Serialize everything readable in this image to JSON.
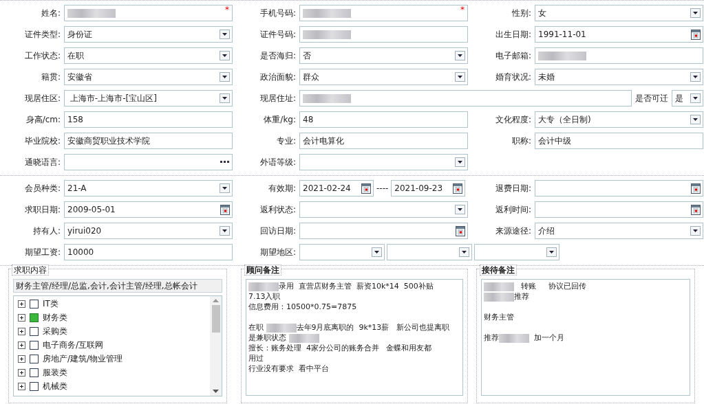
{
  "sections": [
    {
      "fields": [
        {
          "label": "姓名:",
          "kind": "text",
          "redacted": true,
          "required_mark": "*"
        },
        {
          "label": "手机号码:",
          "kind": "text",
          "redacted": true,
          "required_mark": "*"
        },
        {
          "label": "性别:",
          "kind": "select",
          "value": "女"
        },
        {
          "label": "证件类型:",
          "kind": "select",
          "value": "身份证"
        },
        {
          "label": "证件号码:",
          "kind": "text",
          "redacted": true
        },
        {
          "label": "出生日期:",
          "kind": "date",
          "value": "1991-11-01"
        },
        {
          "label": "工作状态:",
          "kind": "select",
          "value": "在职"
        },
        {
          "label": "是否海归:",
          "kind": "select",
          "value": "否"
        },
        {
          "label": "电子邮箱:",
          "kind": "text",
          "redacted": true
        },
        {
          "label": "籍贯:",
          "kind": "select",
          "value": "安徽省"
        },
        {
          "label": "政治面貌:",
          "kind": "select",
          "value": "群众"
        },
        {
          "label": "婚育状况:",
          "kind": "select",
          "value": "未婚"
        },
        {
          "label": "现居住区:",
          "kind": "select",
          "value": " 上海市-上海市-[宝山区]"
        },
        {
          "label": "现居住址:",
          "kind": "address",
          "redacted": true,
          "option": {
            "label": "是否可迁",
            "value": "是"
          }
        },
        {
          "label": "身高/cm:",
          "kind": "text",
          "value": "158"
        },
        {
          "label": "体重/kg:",
          "kind": "text",
          "value": "48"
        },
        {
          "label": "文化程度:",
          "kind": "select",
          "value": "大专（全日制)"
        },
        {
          "label": "毕业院校:",
          "kind": "text",
          "value": "安徽商贸职业技术学院"
        },
        {
          "label": "专业:",
          "kind": "text",
          "value": "会计电算化"
        },
        {
          "label": "职称:",
          "kind": "text",
          "value": "会计中级"
        },
        {
          "label": "通晓语言:",
          "kind": "lookup"
        },
        {
          "label": "外语等级:",
          "kind": "select"
        }
      ]
    },
    {
      "fields": [
        {
          "label": "会员种类:",
          "kind": "select",
          "value": "21-A"
        },
        {
          "label": "有效期:",
          "kind": "date_range",
          "values": [
            "2021-02-24",
            "2021-09-23"
          ],
          "separator": "----"
        },
        {
          "label": "退费日期:",
          "kind": "date"
        },
        {
          "label": "求职日期:",
          "kind": "date",
          "value": "2009-05-01"
        },
        {
          "label": "返利状态:",
          "kind": "select"
        },
        {
          "label": "返利时间:",
          "kind": "date"
        },
        {
          "label": "持有人:",
          "kind": "select",
          "value": "yirui020"
        },
        {
          "label": "回访日期:",
          "kind": "date"
        },
        {
          "label": "来源途径:",
          "kind": "select",
          "value": "介绍"
        },
        {
          "label": "期望工资:",
          "kind": "text",
          "value": "10000"
        },
        {
          "label": "期望地区:",
          "kind": "regions",
          "selects": [
            {
              "kind": "select"
            },
            {
              "kind": "select"
            },
            {
              "kind": "select"
            }
          ]
        }
      ]
    }
  ],
  "job_panel": {
    "legend": "求职内容",
    "summary": "财务主管/经理/总监,会计,会计主管/经理,总帐会计",
    "tree": [
      {
        "label": "IT类",
        "checked": false
      },
      {
        "label": "财务类",
        "checked": true
      },
      {
        "label": "采购类",
        "checked": false
      },
      {
        "label": "电子商务/互联网",
        "checked": false
      },
      {
        "label": "房地产/建筑/物业管理",
        "checked": false
      },
      {
        "label": "服装类",
        "checked": false
      },
      {
        "label": "机械类",
        "checked": false
      }
    ]
  },
  "notes": [
    {
      "legend": "顾问备注",
      "paragraphs": [
        [
          [
            {
              "kind": "redacted"
            },
            {
              "kind": "text",
              "text": "录用  直营店财务主管  薪资10k*14  500补贴"
            }
          ],
          [
            {
              "kind": "text",
              "text": "7.13入职"
            }
          ],
          [
            {
              "kind": "text",
              "text": "信息费用：10500*0.75=7875"
            }
          ]
        ],
        [
          [
            {
              "kind": "text",
              "text": "在职 "
            },
            {
              "kind": "redacted"
            },
            {
              "kind": "text",
              "text": "去年9月底离职的  9k*13薪   新公司也提离职"
            }
          ],
          [
            {
              "kind": "text",
              "text": "是兼职状态 "
            },
            {
              "kind": "redacted"
            }
          ],
          [
            {
              "kind": "text",
              "text": "擅长：账务处理  4家分公司的账务合并   金蝶和用友都"
            }
          ],
          [
            {
              "kind": "text",
              "text": "用过"
            }
          ],
          [
            {
              "kind": "text",
              "text": "行业没有要求  看中平台"
            }
          ]
        ]
      ]
    },
    {
      "legend": "接待备注",
      "paragraphs": [
        [
          [
            {
              "kind": "redacted"
            },
            {
              "kind": "text",
              "text": "   转账     协议已回传"
            }
          ],
          [
            {
              "kind": "redacted"
            },
            {
              "kind": "text",
              "text": "推荐"
            }
          ]
        ],
        [
          [
            {
              "kind": "text",
              "text": "财务主管"
            }
          ]
        ],
        [
          [
            {
              "kind": "text",
              "text": "推荐"
            },
            {
              "kind": "redacted"
            },
            {
              "kind": "text",
              "text": "  加一个月"
            }
          ]
        ]
      ]
    }
  ]
}
